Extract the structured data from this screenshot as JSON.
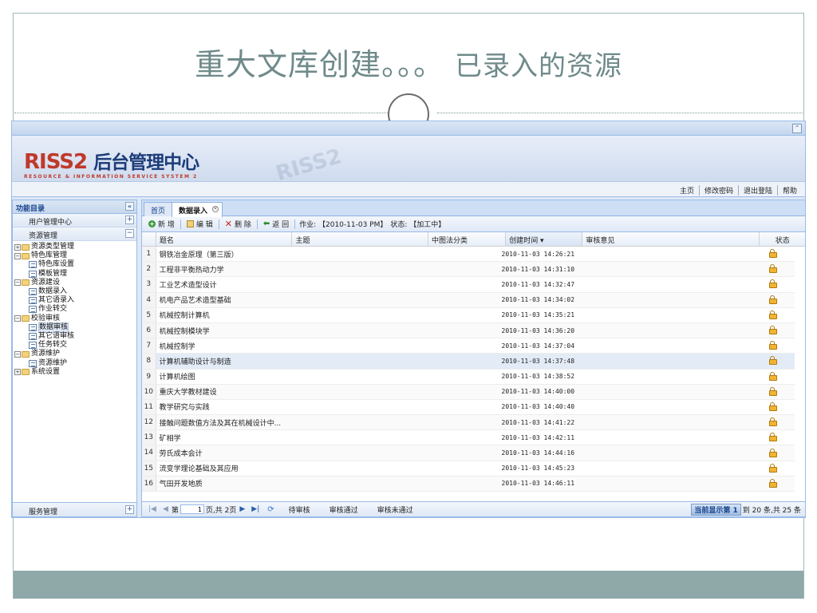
{
  "slide": {
    "title_main": "重大文库创建。。。",
    "title_suffix": "已录入的资源"
  },
  "app": {
    "logo_letters": "RISS2",
    "logo_cn": "后台管理中心",
    "logo_sub": "RESOURCE & INFORMATION SERVICE SYSTEM 2",
    "collapse_symbol": "«",
    "nav_links": [
      "主页",
      "修改密码",
      "退出登陆",
      "帮助"
    ]
  },
  "sidebar": {
    "title": "功能目录",
    "title_tool": "«",
    "accordion": [
      {
        "label": "用户管理中心",
        "tool": "+"
      },
      {
        "label": "资源管理",
        "tool": "−"
      }
    ],
    "tree": [
      {
        "label": "资源类型管理",
        "level": 1,
        "type": "folder",
        "exp": "+"
      },
      {
        "label": "特色库管理",
        "level": 1,
        "type": "folder",
        "exp": "−"
      },
      {
        "label": "特色库设置",
        "level": 2,
        "type": "leaf"
      },
      {
        "label": "模板管理",
        "level": 2,
        "type": "leaf"
      },
      {
        "label": "资源建设",
        "level": 1,
        "type": "folder",
        "exp": "−"
      },
      {
        "label": "数据录入",
        "level": 2,
        "type": "leaf"
      },
      {
        "label": "其它语录入",
        "level": 2,
        "type": "leaf"
      },
      {
        "label": "作业转交",
        "level": 2,
        "type": "leaf"
      },
      {
        "label": "校验审核",
        "level": 1,
        "type": "folder",
        "exp": "−"
      },
      {
        "label": "数据审核",
        "level": 2,
        "type": "leaf",
        "selected": true
      },
      {
        "label": "其它语审核",
        "level": 2,
        "type": "leaf"
      },
      {
        "label": "任务转交",
        "level": 2,
        "type": "leaf"
      },
      {
        "label": "资源维护",
        "level": 1,
        "type": "folder",
        "exp": "−"
      },
      {
        "label": "资源维护",
        "level": 2,
        "type": "leaf"
      },
      {
        "label": "系统设置",
        "level": 1,
        "type": "folder",
        "exp": "+"
      }
    ],
    "service": {
      "label": "服务管理",
      "tool": "+"
    }
  },
  "tabs": {
    "home": "首页",
    "active": "数据录入",
    "close": "×"
  },
  "toolbar": {
    "add": "新 增",
    "edit": "编 辑",
    "delete": "删 除",
    "back": "返 回",
    "job": "作业: 【2010-11-03 PM】",
    "state": "状态: 【加工中】"
  },
  "grid": {
    "headers": {
      "title": "题名",
      "subject": "主题",
      "class": "中图法分类",
      "date": "创建时间 ▾",
      "note": "审核意见",
      "status": "状态"
    },
    "status_icon": "lock-icon",
    "rows": [
      {
        "n": "1",
        "title": "钢铁冶金原理（第三版）",
        "date": "2010-11-03 14:26:21"
      },
      {
        "n": "2",
        "title": "工程非平衡热动力学",
        "date": "2010-11-03 14:31:10"
      },
      {
        "n": "3",
        "title": "工业艺术造型设计",
        "date": "2010-11-03 14:32:47"
      },
      {
        "n": "4",
        "title": "机电产品艺术造型基础",
        "date": "2010-11-03 14:34:02"
      },
      {
        "n": "5",
        "title": "机械控制计算机",
        "date": "2010-11-03 14:35:21"
      },
      {
        "n": "6",
        "title": "机械控制模块学",
        "date": "2010-11-03 14:36:20"
      },
      {
        "n": "7",
        "title": "机械控制学",
        "date": "2010-11-03 14:37:04"
      },
      {
        "n": "8",
        "title": "计算机辅助设计与制造",
        "date": "2010-11-03 14:37:48",
        "hl": true
      },
      {
        "n": "9",
        "title": "计算机绘图",
        "date": "2010-11-03 14:38:52"
      },
      {
        "n": "10",
        "title": "重庆大学教材建设",
        "date": "2010-11-03 14:40:00"
      },
      {
        "n": "11",
        "title": "教学研究与实践",
        "date": "2010-11-03 14:40:40"
      },
      {
        "n": "12",
        "title": "接触问题数值方法及其在机械设计中...",
        "date": "2010-11-03 14:41:22"
      },
      {
        "n": "13",
        "title": "矿相学",
        "date": "2010-11-03 14:42:11"
      },
      {
        "n": "14",
        "title": "劳氏成本会计",
        "date": "2010-11-03 14:44:16"
      },
      {
        "n": "15",
        "title": "流变学理论基础及其应用",
        "date": "2010-11-03 14:45:23"
      },
      {
        "n": "16",
        "title": "气田开发地质",
        "date": "2010-11-03 14:46:11"
      }
    ]
  },
  "paging": {
    "page_prefix": "第",
    "page_value": "1",
    "page_suffix": "页,共 2页",
    "pending": "待审核",
    "approved": "审核通过",
    "rejected": "审核未通过",
    "info_highlight": "当前显示第 1",
    "info_rest": "到 20 条,共 25 条"
  }
}
